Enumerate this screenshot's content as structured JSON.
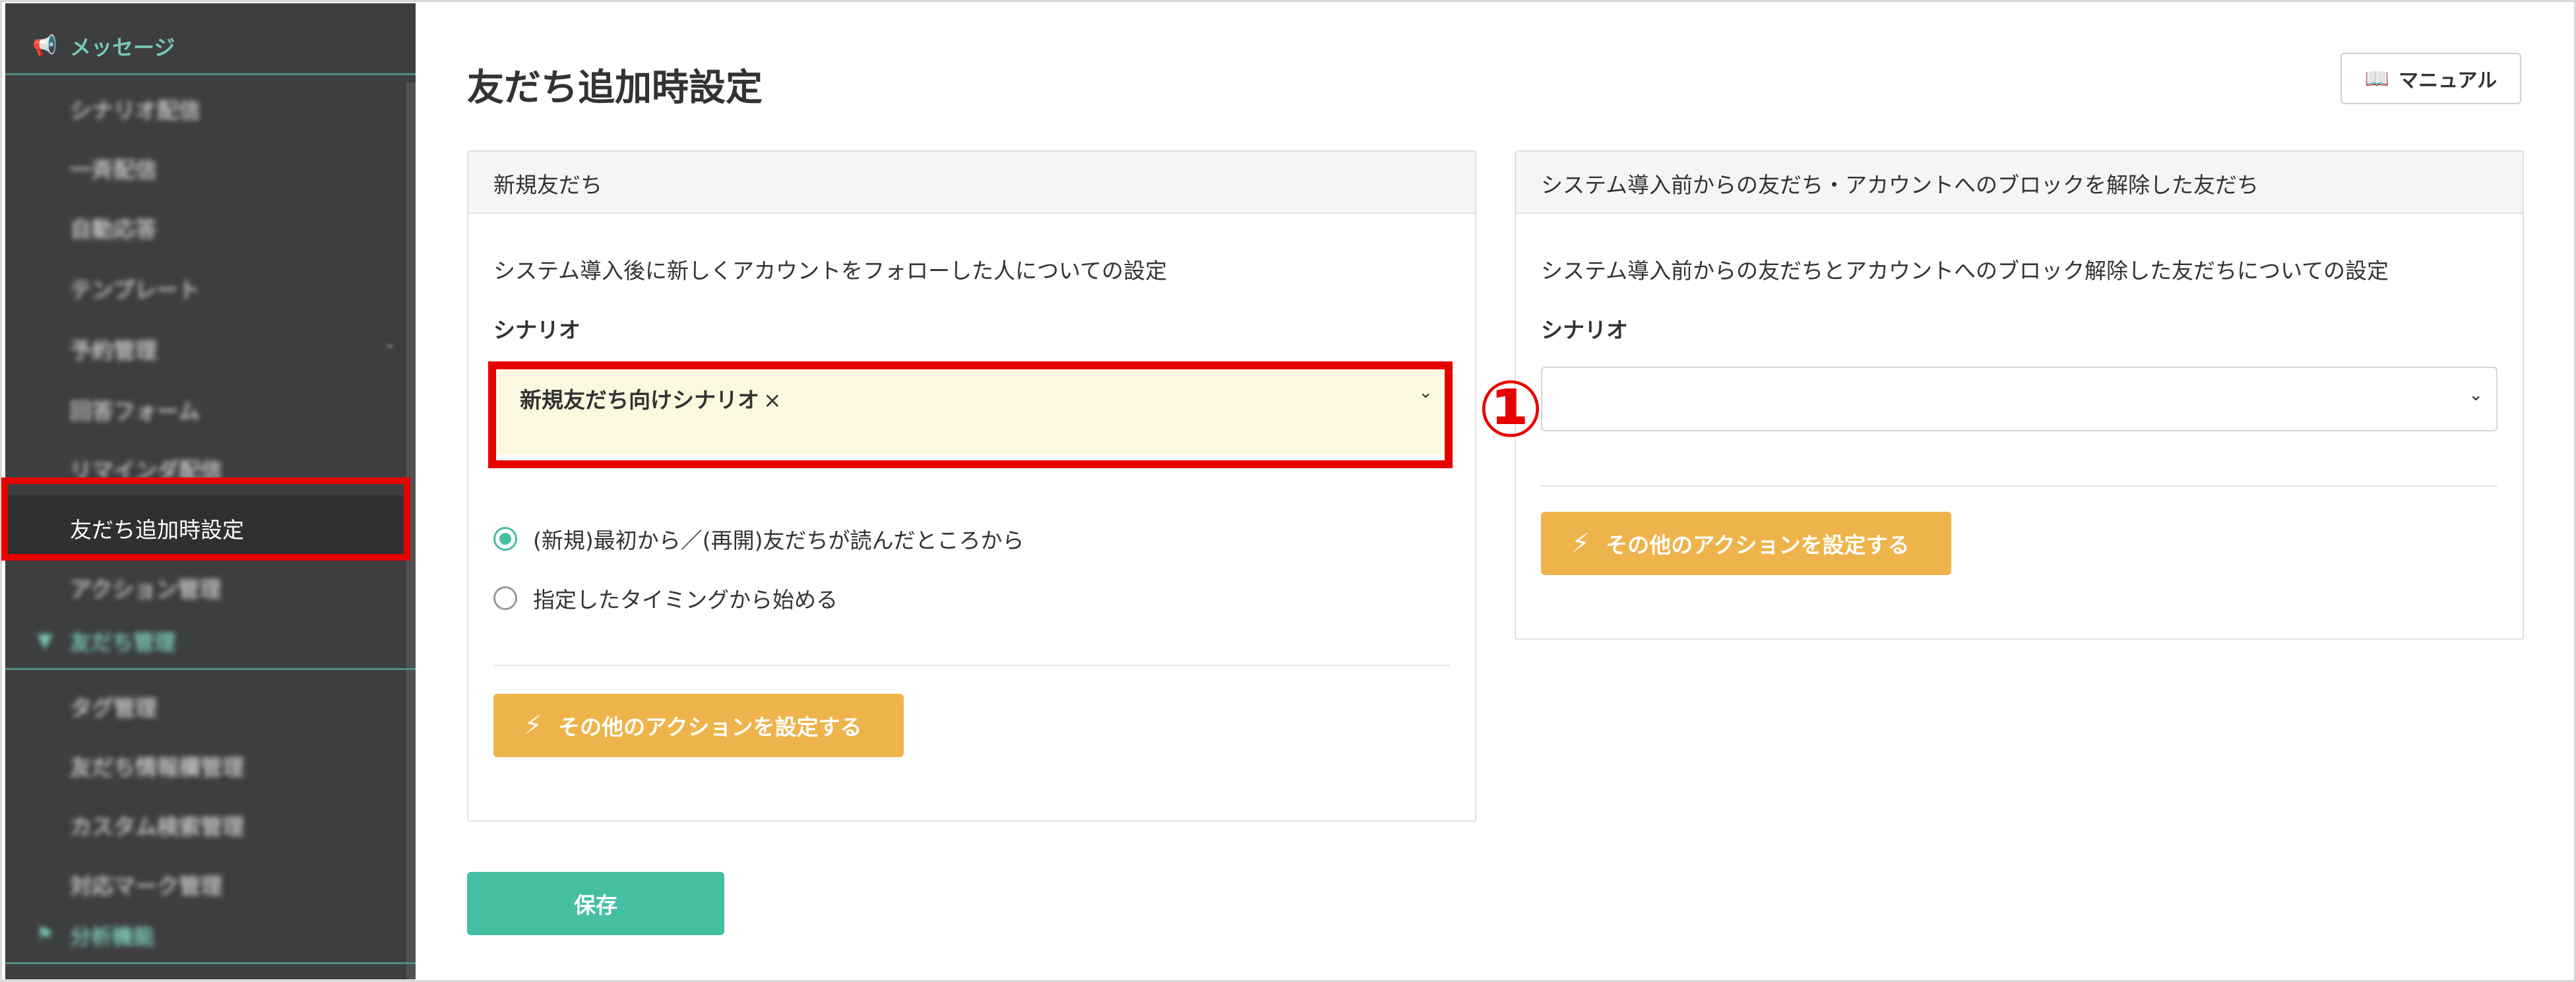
{
  "sidebar": {
    "section_messages": {
      "label": "メッセージ",
      "icon": "megaphone-icon"
    },
    "items": [
      {
        "label": "シナリオ配信"
      },
      {
        "label": "一斉配信"
      },
      {
        "label": "自動応答"
      },
      {
        "label": "テンプレート"
      },
      {
        "label": "予約管理",
        "has_submenu": true
      },
      {
        "label": "回答フォーム"
      },
      {
        "label": "リマインダ配信"
      },
      {
        "label": "友だち追加時設定",
        "active": true
      },
      {
        "label": "アクション管理"
      }
    ],
    "section_friends": {
      "label": "友だち管理",
      "icon": "funnel-icon"
    },
    "friend_items": [
      {
        "label": "タグ管理"
      },
      {
        "label": "友だち情報欄管理"
      },
      {
        "label": "カスタム検索管理"
      },
      {
        "label": "対応マーク管理"
      }
    ],
    "section_analysis": {
      "label": "分析機能",
      "icon": "flag-icon"
    }
  },
  "page": {
    "title": "友だち追加時設定",
    "manual_label": "マニュアル",
    "save_label": "保存"
  },
  "panel_new": {
    "header": "新規友だち",
    "description": "システム導入後に新しくアカウントをフォローした人についての設定",
    "scenario_label": "シナリオ",
    "selected_scenario": "新規友だち向けシナリオ",
    "remove_glyph": "×",
    "radio_options": [
      {
        "label": "(新規)最初から／(再開)友だちが読んだところから",
        "checked": true
      },
      {
        "label": "指定したタイミングから始める",
        "checked": false
      }
    ],
    "action_label": "その他のアクションを設定する"
  },
  "panel_existing": {
    "header": "システム導入前からの友だち・アカウントへのブロックを解除した友だち",
    "description": "システム導入前からの友だちとアカウントへのブロック解除した友だちについての設定",
    "scenario_label": "シナリオ",
    "selected_scenario": "",
    "action_label": "その他のアクションを設定する"
  },
  "annotation": {
    "marker": "①"
  },
  "colors": {
    "sidebar_bg": "#3d3e40",
    "accent_green": "#45bfa1",
    "action_orange": "#eeb34a",
    "highlight_red": "#e80000",
    "selected_bg": "#fdf9e1"
  }
}
